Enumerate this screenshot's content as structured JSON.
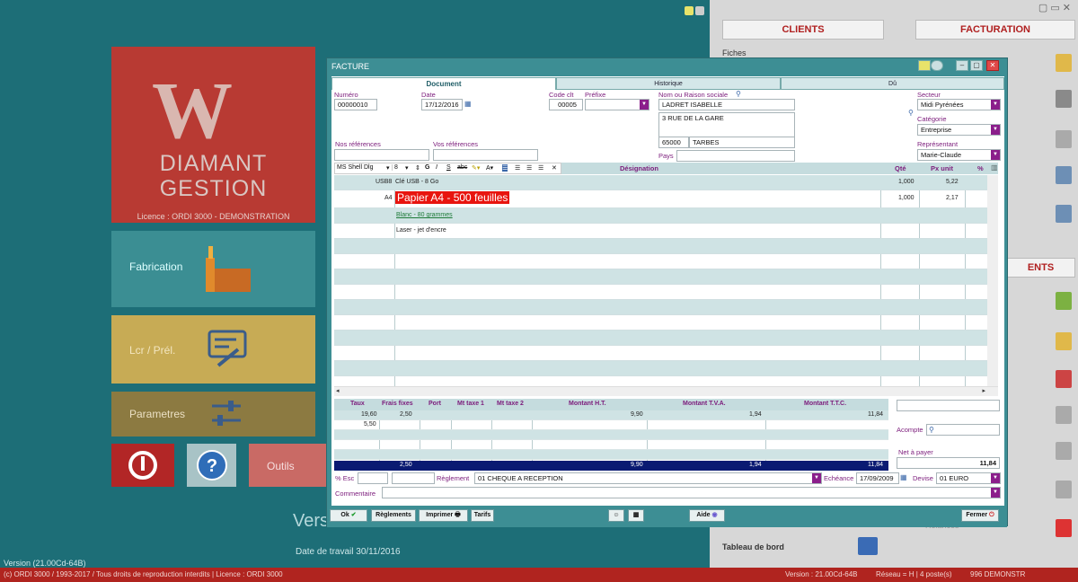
{
  "desktop": {
    "logo_letter": "W",
    "logo_line1": "DIAMANT",
    "logo_line2": "GESTION",
    "license": "Licence : ORDI 3000 - DEMONSTRATION",
    "tiles": {
      "fabrication": "Fabrication",
      "lcr": "Lcr / Prél.",
      "parametres": "Parametres",
      "outils": "Outils"
    },
    "version_big": "Vers",
    "date_travail": "Date de travail  30/11/2016",
    "version_small": "Version (21.00Cd-64B)"
  },
  "status_bar": {
    "copyright": "(c) ORDI 3000 / 1993-2017 / Tous droits de reproduction interdits | Licence : ORDI 3000",
    "version": "Version : 21.00Cd-64B",
    "network": "Réseau = H | 4 poste(s)",
    "demo": "996 DEMONSTR"
  },
  "right_panel": {
    "clients": "CLIENTS",
    "facturation": "FACTURATION",
    "fiches": "Fiches",
    "ents": "ENTS",
    "tableau": "Tableau de bord",
    "relances": "Relances"
  },
  "dialog": {
    "title": "FACTURE",
    "tabs": [
      "Document",
      "Historique",
      "Dû"
    ],
    "labels": {
      "numero": "Numéro",
      "date": "Date",
      "code_clt": "Code clt",
      "prefixe": "Préfixe",
      "nom": "Nom ou Raison sociale",
      "secteur": "Secteur",
      "categorie": "Catégorie",
      "nos_ref": "Nos références",
      "vos_ref": "Vos références",
      "representant": "Représentant",
      "pays": "Pays"
    },
    "values": {
      "numero": "00000010",
      "date": "17/12/2016",
      "code_clt": "00005",
      "prefixe": "",
      "nom": "LADRET ISABELLE",
      "adresse": "3 RUE DE LA GARE",
      "cp": "65000",
      "ville": "TARBES",
      "pays": "",
      "secteur": "Midi Pyrénées",
      "categorie": "Entreprise",
      "representant": "Marie-Claude",
      "nos_ref": "",
      "vos_ref": ""
    },
    "toolbar": {
      "font": "MS Shell Dlg",
      "size": "8"
    },
    "grid_headers": {
      "designation": "Désignation",
      "qte": "Qté",
      "px_unit": "Px unit",
      "pct": "%"
    },
    "lines": [
      {
        "code": "USB8",
        "designation": "Clé USB - 8 Go",
        "qte": "1,000",
        "px": "5,22"
      },
      {
        "code": "A4",
        "designation": "Papier A4 - 500 feuilles",
        "qte": "1,000",
        "px": "2,17"
      },
      {
        "code": "",
        "designation": "Blanc - 80 grammes",
        "qte": "",
        "px": ""
      },
      {
        "code": "",
        "designation": "Laser - jet d'encre",
        "qte": "",
        "px": ""
      }
    ],
    "totals_headers": [
      "Taux",
      "Frais fixes",
      "Port",
      "Mt taxe 1",
      "Mt taxe 2",
      "Montant  H.T.",
      "Montant T.V.A.",
      "Montant T.T.C."
    ],
    "totals_rows": [
      {
        "taux": "19,60",
        "frais": "2,50",
        "ht": "9,90",
        "tva": "1,94",
        "ttc": "11,84"
      },
      {
        "taux": "5,50",
        "frais": "",
        "ht": "",
        "tva": "",
        "ttc": ""
      }
    ],
    "totals_sum": {
      "frais": "2,50",
      "ht": "9,90",
      "tva": "1,94",
      "ttc": "11,84"
    },
    "acompte_label": "Acompte",
    "net_label": "Net à payer",
    "net_value": "11,84",
    "esc_label": "% Esc",
    "reglement_label": "Règlement",
    "reglement_value": "01 CHEQUE A RECEPTION",
    "echeance_label": "Echéance",
    "echeance_value": "17/09/2009",
    "devise_label": "Devise",
    "devise_value": "01 EURO",
    "commentaire_label": "Commentaire",
    "buttons": {
      "ok": "Ok",
      "reglements": "Règlements",
      "imprimer": "Imprimer",
      "tarifs": "Tarifs",
      "aide": "Aide",
      "fermer": "Fermer"
    }
  }
}
